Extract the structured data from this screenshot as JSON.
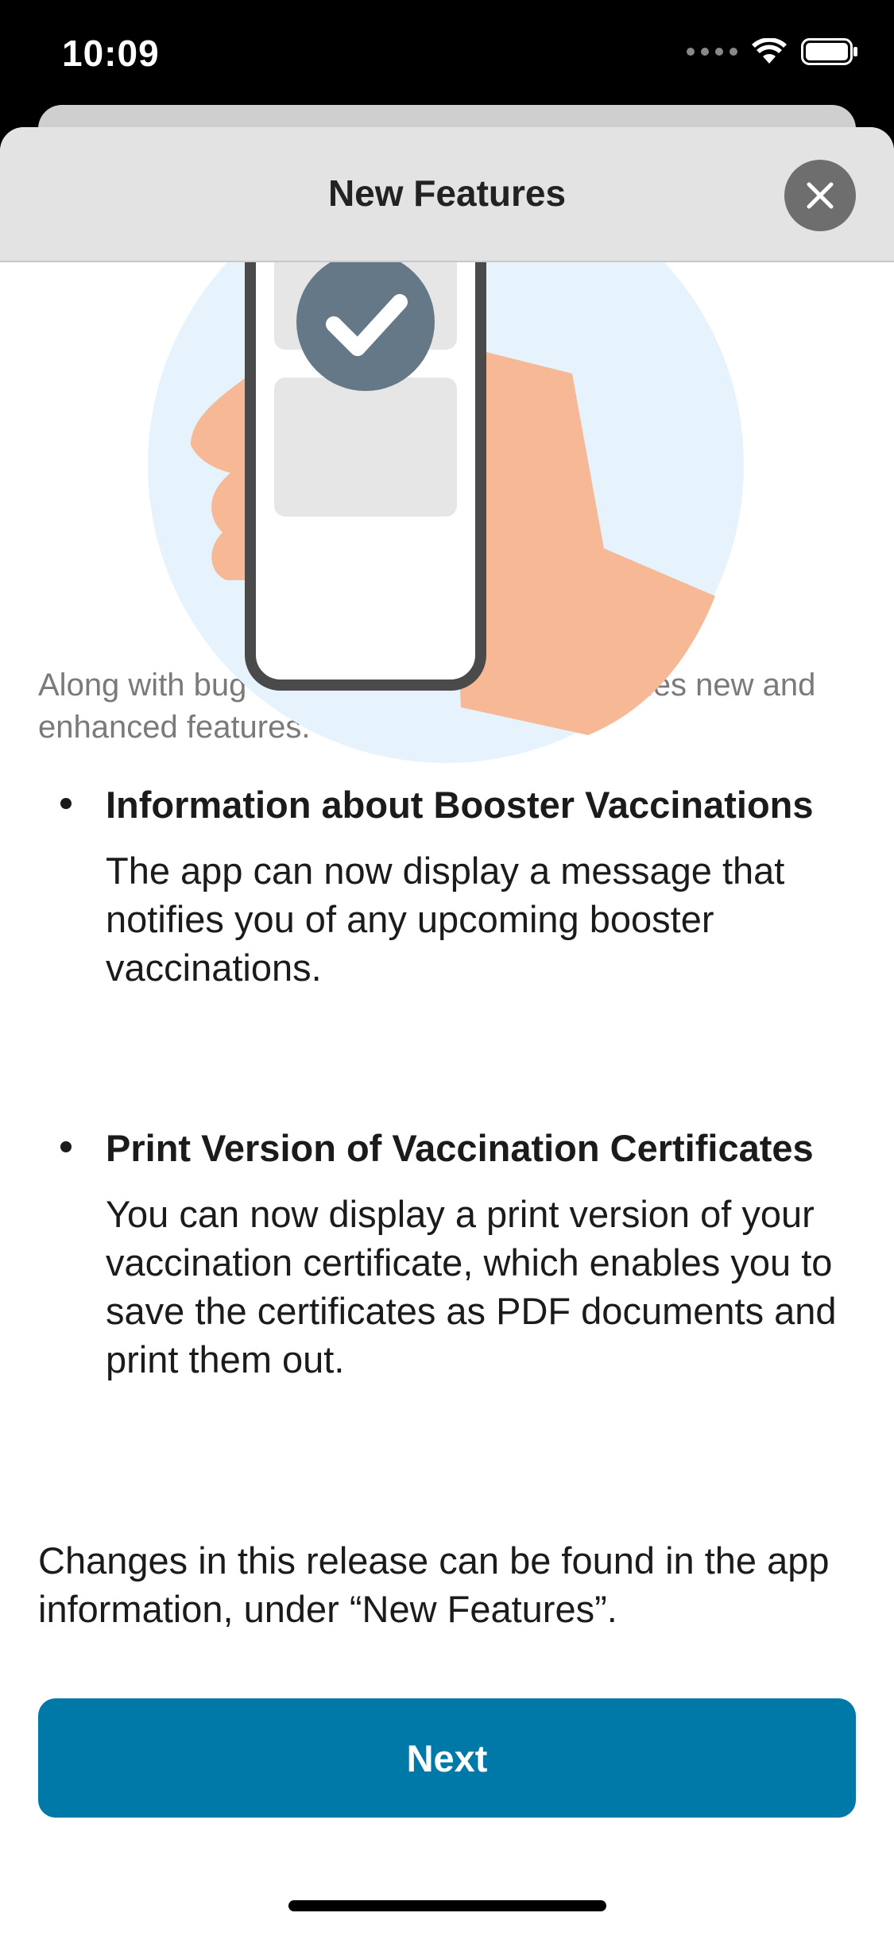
{
  "status_bar": {
    "time": "10:09",
    "icons": [
      "cellular-signal-icon",
      "wifi-icon",
      "battery-icon"
    ]
  },
  "nav": {
    "title": "New Features",
    "close_icon": "close-icon"
  },
  "illustration": {
    "description_icon": "phone-check-illustration",
    "colors": {
      "circle": "#e6f3fc",
      "hand": "#f7b995",
      "phone_frame": "#4a4a4a",
      "check_circle": "#657888"
    }
  },
  "intro": "Along with bug fixes, this update also includes new and enhanced features.",
  "features": [
    {
      "title": "Information about Booster Vaccinations",
      "text": "The app can now display a message that notifies you of any upcoming booster vaccinations."
    },
    {
      "title": "Print Version of Vaccination Certificates",
      "text": "You can now display a print version of your vaccination certificate, which enables you to save the certificates as PDF documents and print them out."
    }
  ],
  "footer_note": "Changes in this release can be found in the app information, under “New Features”.",
  "next_button": "Next",
  "colors": {
    "accent": "#0079a8",
    "text": "#1b1b1b",
    "secondary_text": "#7a7a7a"
  }
}
